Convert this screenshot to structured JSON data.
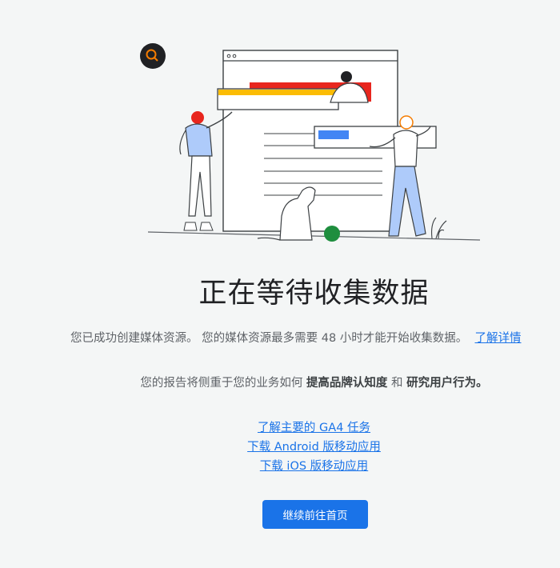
{
  "header": {
    "title": "正在等待收集数据"
  },
  "info": {
    "line1_text": "您已成功创建媒体资源。 您的媒体资源最多需要 48 小时才能开始收集数据。",
    "learn_more": "了解详情",
    "line2_prefix": "您的报告将侧重于您的业务如何",
    "goal1": "提高品牌认知度",
    "conj": "和",
    "goal2": "研究用户行为。"
  },
  "links": [
    "了解主要的 GA4 任务",
    "下载 Android 版移动应用",
    "下载 iOS 版移动应用"
  ],
  "button": {
    "continue_label": "继续前往首页"
  },
  "colors": {
    "primary": "#1a73e8",
    "background": "#f4f6f6",
    "title": "#202124"
  }
}
